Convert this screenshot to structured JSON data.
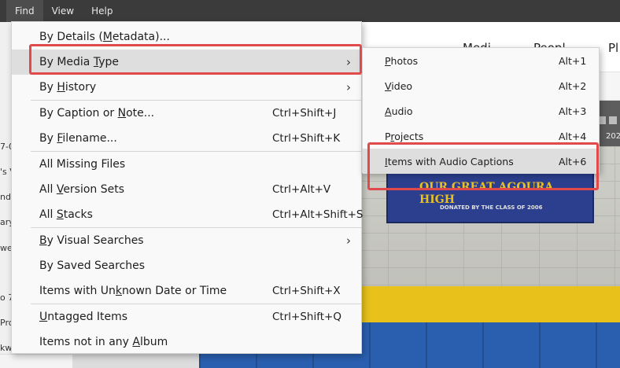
{
  "menubar": {
    "items": [
      "Find",
      "View",
      "Help"
    ]
  },
  "background": {
    "header_fragments": [
      "Medi",
      "Peopl",
      "Pl"
    ],
    "left_fragments": [
      "7-0",
      "'s V",
      "nda",
      "ary",
      "we",
      "o 7",
      "Pro",
      "kw"
    ],
    "timeline_year": "202",
    "banner_line1": "OUR GREAT AGOURA HIGH",
    "banner_line2": "DONATED BY THE CLASS OF 2006"
  },
  "find_menu": {
    "items": [
      {
        "pre": "By Details (",
        "u": "M",
        "post": "etadata)...",
        "shortcut": "",
        "arrow": ""
      },
      {
        "pre": "By Media ",
        "u": "T",
        "post": "ype",
        "shortcut": "",
        "arrow": "›"
      },
      {
        "pre": "By ",
        "u": "H",
        "post": "istory",
        "shortcut": "",
        "arrow": "›"
      },
      {
        "pre": "By Caption or ",
        "u": "N",
        "post": "ote...",
        "shortcut": "Ctrl+Shift+J",
        "arrow": ""
      },
      {
        "pre": "By ",
        "u": "F",
        "post": "ilename...",
        "shortcut": "Ctrl+Shift+K",
        "arrow": ""
      },
      {
        "pre": "All Missing Files",
        "u": "",
        "post": "",
        "shortcut": "",
        "arrow": ""
      },
      {
        "pre": "All ",
        "u": "V",
        "post": "ersion Sets",
        "shortcut": "Ctrl+Alt+V",
        "arrow": ""
      },
      {
        "pre": "All ",
        "u": "S",
        "post": "tacks",
        "shortcut": "Ctrl+Alt+Shift+S",
        "arrow": ""
      },
      {
        "pre": "",
        "u": "B",
        "post": "y Visual Searches",
        "shortcut": "",
        "arrow": "›"
      },
      {
        "pre": "By Saved Searches",
        "u": "",
        "post": "",
        "shortcut": "",
        "arrow": ""
      },
      {
        "pre": "Items with Un",
        "u": "k",
        "post": "nown Date or Time",
        "shortcut": "Ctrl+Shift+X",
        "arrow": ""
      },
      {
        "pre": "",
        "u": "U",
        "post": "ntagged Items",
        "shortcut": "Ctrl+Shift+Q",
        "arrow": ""
      },
      {
        "pre": "Items not in any ",
        "u": "A",
        "post": "lbum",
        "shortcut": "",
        "arrow": ""
      }
    ]
  },
  "media_submenu": {
    "items": [
      {
        "pre": "",
        "u": "P",
        "post": "hotos",
        "shortcut": "Alt+1"
      },
      {
        "pre": "",
        "u": "V",
        "post": "ideo",
        "shortcut": "Alt+2"
      },
      {
        "pre": "",
        "u": "A",
        "post": "udio",
        "shortcut": "Alt+3"
      },
      {
        "pre": "P",
        "u": "r",
        "post": "ojects",
        "shortcut": "Alt+4"
      },
      {
        "pre": "",
        "u": "I",
        "post": "tems with Audio Captions",
        "shortcut": "Alt+6"
      }
    ]
  },
  "colors": {
    "highlight_border": "#e04a4a",
    "menu_bg": "#f9f9f9",
    "menubar_bg": "#3b3b3b"
  }
}
